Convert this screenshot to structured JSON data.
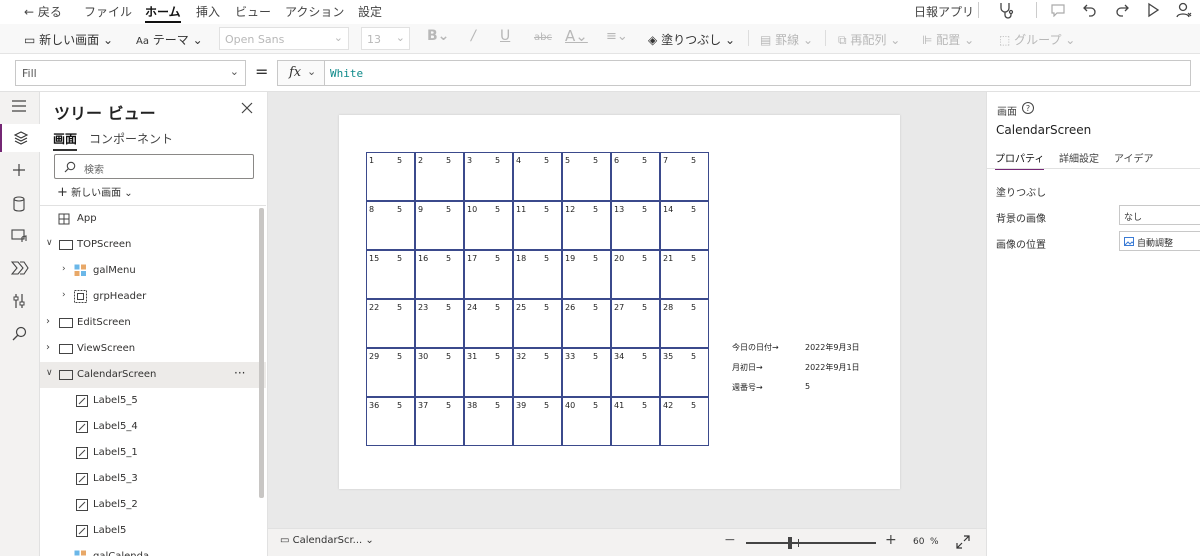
{
  "menu": {
    "back": "戻る",
    "items": [
      "ファイル",
      "ホーム",
      "挿入",
      "ビュー",
      "アクション",
      "設定"
    ],
    "app_name": "日報アプリ"
  },
  "toolbar": {
    "new_screen": "新しい画面",
    "theme": "テーマ",
    "font": "Open Sans",
    "font_size": "13",
    "fill": "塗りつぶし",
    "border": "罫線",
    "reorder": "再配列",
    "align": "配置",
    "group": "グループ"
  },
  "formula": {
    "property": "Fill",
    "value": "White"
  },
  "tree": {
    "title": "ツリー ビュー",
    "tabs": [
      "画面",
      "コンポーネント"
    ],
    "search_placeholder": "検索",
    "new_screen": "新しい画面",
    "items": [
      {
        "label": "App",
        "type": "app"
      },
      {
        "label": "TOPScreen",
        "type": "screen"
      },
      {
        "label": "galMenu",
        "type": "gallery"
      },
      {
        "label": "grpHeader",
        "type": "group"
      },
      {
        "label": "EditScreen",
        "type": "screen"
      },
      {
        "label": "ViewScreen",
        "type": "screen"
      },
      {
        "label": "CalendarScreen",
        "type": "screen",
        "more": "···"
      },
      {
        "label": "Label5_5",
        "type": "label"
      },
      {
        "label": "Label5_4",
        "type": "label"
      },
      {
        "label": "Label5_1",
        "type": "label"
      },
      {
        "label": "Label5_3",
        "type": "label"
      },
      {
        "label": "Label5_2",
        "type": "label"
      },
      {
        "label": "Label5",
        "type": "label"
      },
      {
        "label": "galCalenda",
        "type": "gallery"
      }
    ]
  },
  "calendar": {
    "week_value": "5",
    "days": [
      [
        "1",
        "2",
        "3",
        "4",
        "5",
        "6",
        "7"
      ],
      [
        "8",
        "9",
        "10",
        "11",
        "12",
        "13",
        "14"
      ],
      [
        "15",
        "16",
        "17",
        "18",
        "19",
        "20",
        "21"
      ],
      [
        "22",
        "23",
        "24",
        "25",
        "26",
        "27",
        "28"
      ],
      [
        "29",
        "30",
        "31",
        "32",
        "33",
        "34",
        "35"
      ],
      [
        "36",
        "37",
        "38",
        "39",
        "40",
        "41",
        "42"
      ]
    ]
  },
  "info": {
    "today_label": "今日の日付→",
    "today_value": "2022年9月3日",
    "first_label": "月初日→",
    "first_value": "2022年9月1日",
    "week_label": "週番号→",
    "week_value": "5"
  },
  "statusbar": {
    "screen": "CalendarScr...",
    "zoom": "60",
    "zoom_unit": "%"
  },
  "props": {
    "section": "画面",
    "screen_name": "CalendarScreen",
    "tabs": [
      "プロパティ",
      "詳細設定",
      "アイデア"
    ],
    "fill_label": "塗りつぶし",
    "bg_image_label": "背景の画像",
    "bg_image_value": "なし",
    "image_pos_label": "画像の位置",
    "image_pos_value": "自動調整"
  },
  "colors": {
    "accent": "#742774",
    "grid": "#3b4a8c",
    "formula_text": "#0e8a8a"
  }
}
